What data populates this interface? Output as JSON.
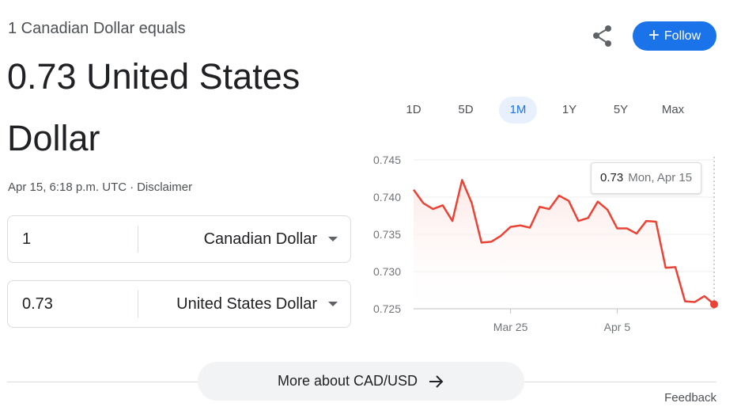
{
  "header": {
    "subtitle": "1 Canadian Dollar equals",
    "value_line1": "0.73 United States",
    "value_line2": "Dollar",
    "timestamp": "Apr 15, 6:18 p.m. UTC",
    "separator": "·",
    "disclaimer": "Disclaimer"
  },
  "actions": {
    "share_icon": "share-icon",
    "follow_label": "Follow",
    "follow_icon": "+"
  },
  "converter": {
    "from": {
      "amount": "1",
      "currency": "Canadian Dollar"
    },
    "to": {
      "amount": "0.73",
      "currency": "United States Dollar"
    }
  },
  "ranges": {
    "items": [
      "1D",
      "5D",
      "1M",
      "1Y",
      "5Y",
      "Max"
    ],
    "selected": "1M"
  },
  "tooltip": {
    "value": "0.73",
    "date": "Mon, Apr 15"
  },
  "chart_data": {
    "type": "area",
    "y_ticks": [
      "0.745",
      "0.740",
      "0.735",
      "0.730",
      "0.725"
    ],
    "ylim": [
      0.725,
      0.745
    ],
    "x_ticks": [
      {
        "label": "Mar 25",
        "index": 10
      },
      {
        "label": "Apr 5",
        "index": 21
      }
    ],
    "series": [
      {
        "values": [
          0.741,
          0.7392,
          0.7384,
          0.7389,
          0.7368,
          0.7423,
          0.7392,
          0.7339,
          0.734,
          0.7348,
          0.736,
          0.7362,
          0.7359,
          0.7387,
          0.7384,
          0.7402,
          0.7395,
          0.7368,
          0.7372,
          0.7394,
          0.7383,
          0.7358,
          0.7358,
          0.7351,
          0.7368,
          0.7367,
          0.7305,
          0.7306,
          0.726,
          0.7259,
          0.7267,
          0.7256
        ]
      }
    ],
    "line_color": "#ea4335",
    "fill_color": "#fce8e6",
    "grid": true
  },
  "more": {
    "label": "More about CAD/USD",
    "icon": "arrow-right-icon"
  },
  "feedback": "Feedback"
}
